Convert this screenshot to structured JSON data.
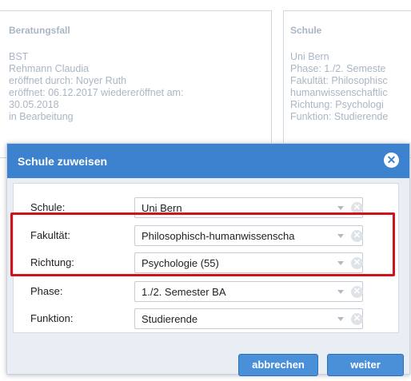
{
  "background": {
    "left_panel": {
      "title": "Beratungsfall",
      "lines": [
        "BST",
        "Rehmann Claudia",
        "eröffnet durch: Noyer Ruth",
        "eröffnet: 06.12.2017 wiedereröffnet am:",
        "30.05.2018",
        "in Bearbeitung"
      ]
    },
    "right_panel": {
      "title": "Schule",
      "lines": [
        "Uni Bern",
        "Phase: 1./2. Semeste",
        "Fakultät: Philosophisc",
        "humanwissenschaftlic",
        "Richtung: Psychologi",
        "Funktion: Studierende"
      ]
    }
  },
  "modal": {
    "title": "Schule zuweisen",
    "close_icon": "close-icon",
    "fields": [
      {
        "label": "Schule:",
        "value": "Uni Bern"
      },
      {
        "label": "Fakultät:",
        "value": "Philosophisch-humanwissenscha"
      },
      {
        "label": "Richtung:",
        "value": "Psychologie (55)"
      },
      {
        "label": "Phase:",
        "value": "1./2. Semester BA"
      },
      {
        "label": "Funktion:",
        "value": "Studierende"
      }
    ],
    "buttons": {
      "cancel": "abbrechen",
      "next": "weiter"
    }
  },
  "colors": {
    "header": "#3d82cf",
    "highlight": "#d0131a",
    "button": "#4a90d9"
  }
}
